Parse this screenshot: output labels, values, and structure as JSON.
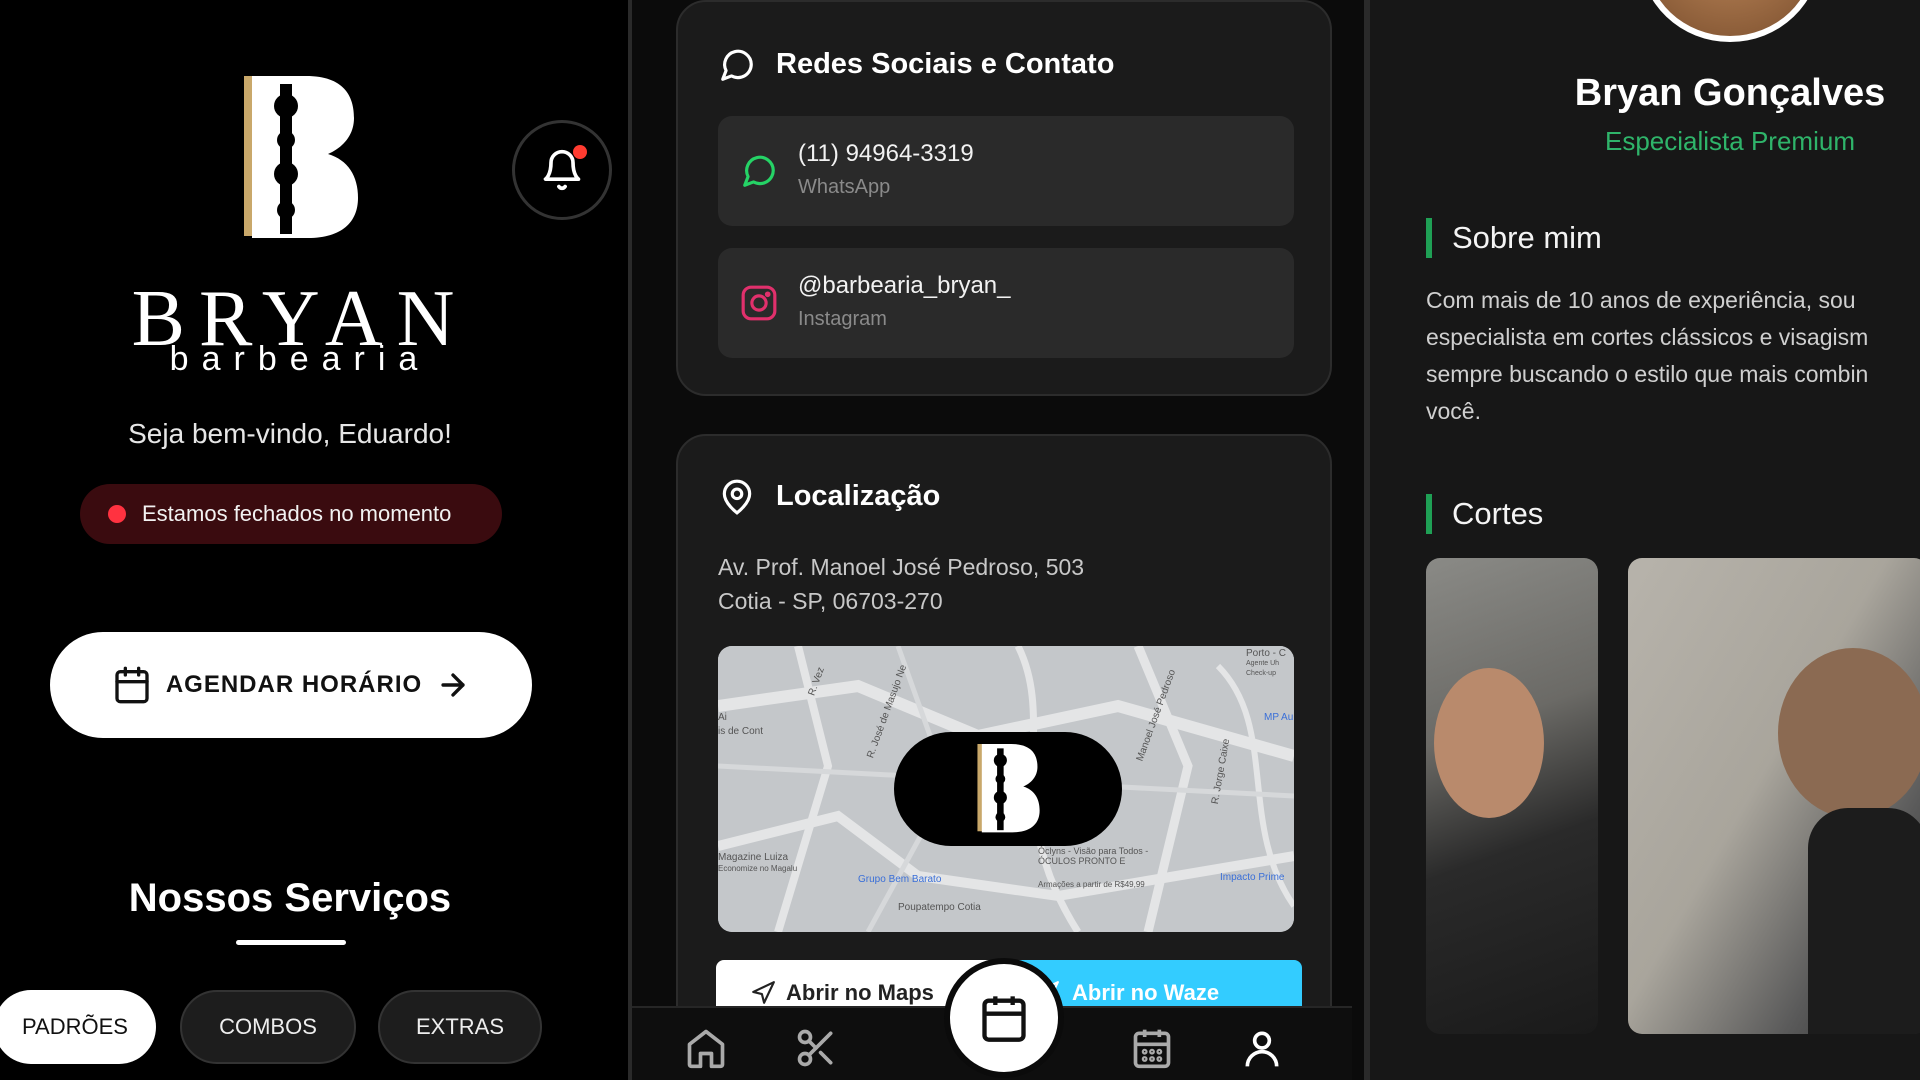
{
  "home": {
    "brand_name": "BRYAN",
    "brand_sub": "barbearia",
    "welcome": "Seja bem-vindo, Eduardo!",
    "status": "Estamos fechados no momento",
    "cta_label": "AGENDAR HORÁRIO",
    "services_title": "Nossos Serviços",
    "categories": [
      "PADRÕES",
      "COMBOS",
      "EXTRAS"
    ],
    "icons": [
      "bell-icon",
      "calendar-icon",
      "arrow-right-icon"
    ]
  },
  "contact": {
    "social_title": "Redes Sociais e Contato",
    "whatsapp": {
      "value": "(11) 94964-3319",
      "label": "WhatsApp"
    },
    "instagram": {
      "value": "@barbearia_bryan_",
      "label": "Instagram"
    },
    "location_title": "Localização",
    "address_line1": "Av. Prof. Manoel José Pedroso, 503",
    "address_line2": "Cotia - SP, 06703-270",
    "map_labels": [
      "R. José de Masujo Ne",
      "R. Vez",
      "Magazine Luiza",
      "Economize no Magalu",
      "Grupo Bem Barato",
      "Poupatempo Cotia",
      "Óclyns - Visão para Todos - ÓCULOS PRONTO E",
      "Armações a partir de R$49,99",
      "Impacto Prime",
      "MP Au",
      "Porto - C",
      "Agente Uh",
      "Check-up",
      "Ai",
      "is de Cont",
      "Manoel José Pedroso",
      "R. Jorge Caixe"
    ],
    "btn_maps": "Abrir no Maps",
    "btn_waze": "Abrir no Waze",
    "colors": {
      "whatsapp": "#25d366",
      "instagram": "#e1306c",
      "waze": "#33ccff"
    }
  },
  "profile": {
    "name": "Bryan Gonçalves",
    "role": "Especialista Premium",
    "about_title": "Sobre mim",
    "about_lines": [
      "Com mais de 10 anos de experiência, sou",
      "especialista em cortes clássicos e visagism",
      "sempre buscando o estilo que mais combin",
      "você."
    ],
    "cuts_title": "Cortes",
    "accent": "#1fa055"
  }
}
